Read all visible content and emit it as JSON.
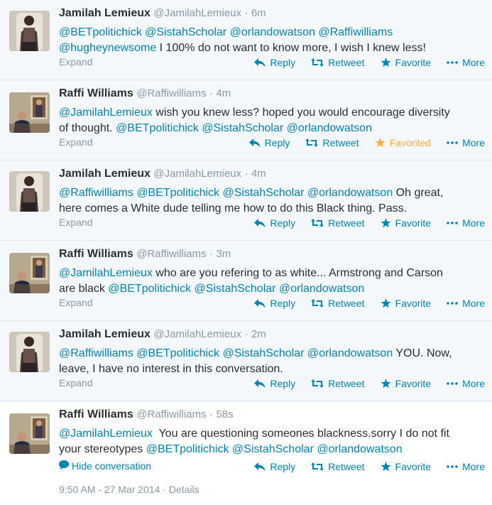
{
  "tweets": [
    {
      "name": "Jamilah Lemieux",
      "handle": "@JamilahLemieux",
      "time": "6m",
      "line1": [
        {
          "t": "@BETpolitichick",
          "m": true
        },
        {
          "t": " ",
          "m": false
        },
        {
          "t": "@SistahScholar",
          "m": true
        },
        {
          "t": " ",
          "m": false
        },
        {
          "t": "@orlandowatson",
          "m": true
        },
        {
          "t": " ",
          "m": false
        },
        {
          "t": "@Raffiwilliams",
          "m": true
        }
      ],
      "line2": [
        {
          "t": "@hugheynewsome",
          "m": true
        },
        {
          "t": " I 100% do not want to know more, I wish I knew less!",
          "m": false
        }
      ],
      "expand": "Expand",
      "favorited": false
    },
    {
      "name": "Raffi Williams",
      "handle": "@Raffiwilliams",
      "time": "4m",
      "line1": [
        {
          "t": "@JamilahLemieux",
          "m": true
        },
        {
          "t": " wish you knew less? hoped you would encourage diversity",
          "m": false
        }
      ],
      "line2": [
        {
          "t": "of thought. ",
          "m": false
        },
        {
          "t": "@BETpolitichick",
          "m": true
        },
        {
          "t": " ",
          "m": false
        },
        {
          "t": "@SistahScholar",
          "m": true
        },
        {
          "t": " ",
          "m": false
        },
        {
          "t": "@orlandowatson",
          "m": true
        }
      ],
      "expand": "Expand",
      "favorited": true
    },
    {
      "name": "Jamilah Lemieux",
      "handle": "@JamilahLemieux",
      "time": "4m",
      "line1": [
        {
          "t": "@Raffiwilliams",
          "m": true
        },
        {
          "t": " ",
          "m": false
        },
        {
          "t": "@BETpolitichick",
          "m": true
        },
        {
          "t": " ",
          "m": false
        },
        {
          "t": "@SistahScholar",
          "m": true
        },
        {
          "t": " ",
          "m": false
        },
        {
          "t": "@orlandowatson",
          "m": true
        },
        {
          "t": " Oh great,",
          "m": false
        }
      ],
      "line2": [
        {
          "t": "here comes a White dude telling me how to do this Black thing. Pass.",
          "m": false
        }
      ],
      "expand": "Expand",
      "favorited": false
    },
    {
      "name": "Raffi Williams",
      "handle": "@Raffiwilliams",
      "time": "3m",
      "line1": [
        {
          "t": "@JamilahLemieux",
          "m": true
        },
        {
          "t": " who are you refering to as white... Armstrong and Carson",
          "m": false
        }
      ],
      "line2": [
        {
          "t": "are black ",
          "m": false
        },
        {
          "t": "@BETpolitichick",
          "m": true
        },
        {
          "t": " ",
          "m": false
        },
        {
          "t": "@SistahScholar",
          "m": true
        },
        {
          "t": " ",
          "m": false
        },
        {
          "t": "@orlandowatson",
          "m": true
        }
      ],
      "expand": "Expand",
      "favorited": false
    },
    {
      "name": "Jamilah Lemieux",
      "handle": "@JamilahLemieux",
      "time": "2m",
      "line1": [
        {
          "t": "@Raffiwilliams",
          "m": true
        },
        {
          "t": " ",
          "m": false
        },
        {
          "t": "@BETpolitichick",
          "m": true
        },
        {
          "t": " ",
          "m": false
        },
        {
          "t": "@SistahScholar",
          "m": true
        },
        {
          "t": " ",
          "m": false
        },
        {
          "t": "@orlandowatson",
          "m": true
        },
        {
          "t": " YOU. Now,",
          "m": false
        }
      ],
      "line2": [
        {
          "t": "leave, I have no interest in this conversation.",
          "m": false
        }
      ],
      "expand": "Expand",
      "favorited": false
    },
    {
      "name": "Raffi Williams",
      "handle": "@Raffiwilliams",
      "time": "58s",
      "line1": [
        {
          "t": "@JamilahLemieux",
          "m": true
        },
        {
          "t": "  You are questioning someones blackness.sorry I do not fit",
          "m": false
        }
      ],
      "line2": [
        {
          "t": "your stereotypes ",
          "m": false
        },
        {
          "t": "@BETpolitichick",
          "m": true
        },
        {
          "t": " ",
          "m": false
        },
        {
          "t": "@SistahScholar",
          "m": true
        },
        {
          "t": " ",
          "m": false
        },
        {
          "t": "@orlandowatson",
          "m": true
        }
      ],
      "hide_conversation": "Hide conversation",
      "footer_timestamp": "9:50 AM - 27 Mar 2014",
      "footer_details": "Details",
      "favorited": false
    }
  ],
  "actions": {
    "reply": "Reply",
    "retweet": "Retweet",
    "favorite": "Favorite",
    "favorited": "Favorited",
    "more": "More"
  },
  "separator": "·",
  "colors": {
    "link": "#0084b4",
    "meta": "#8899a6",
    "text": "#292f33",
    "favorited": "#ffac33",
    "tweet_bg": "#f5f8fa",
    "border": "#e1e8ed"
  },
  "icons": {
    "reply": "reply-icon",
    "retweet": "retweet-icon",
    "favorite": "star-icon",
    "more": "more-dots-icon",
    "conversation": "speech-bubble-icon"
  }
}
